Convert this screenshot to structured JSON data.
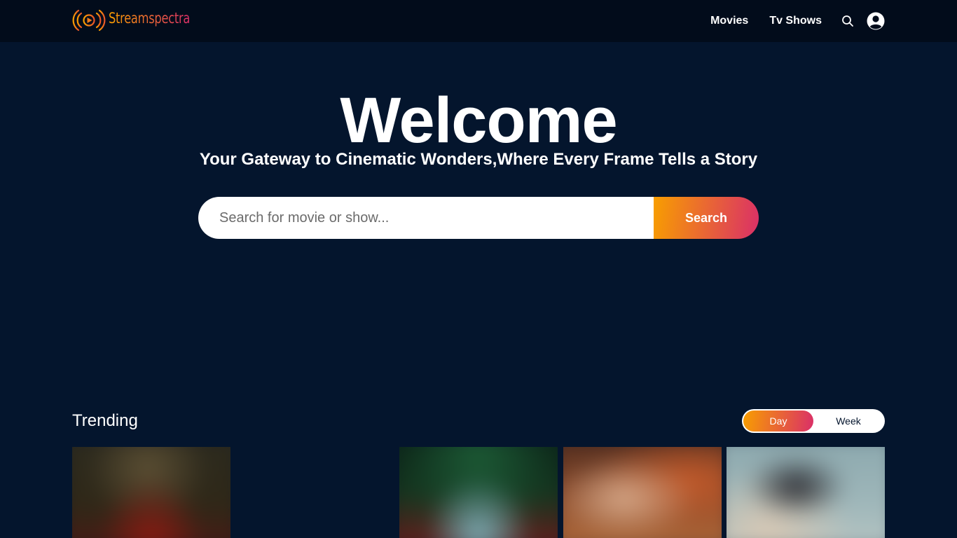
{
  "header": {
    "brand": "Streamspectra",
    "nav": [
      {
        "label": "Movies"
      },
      {
        "label": "Tv Shows"
      }
    ],
    "icons": [
      "search-icon",
      "user-icon"
    ]
  },
  "hero": {
    "title": "Welcome",
    "subtitle": "Your Gateway to Cinematic Wonders,Where Every Frame Tells a Story",
    "search": {
      "placeholder": "Search for movie or show...",
      "value": "",
      "button_label": "Search"
    }
  },
  "trending": {
    "title": "Trending",
    "tabs": [
      {
        "label": "Day",
        "active": true
      },
      {
        "label": "Week",
        "active": false
      }
    ]
  },
  "colors": {
    "background": "#04152d",
    "header": "#020c1b",
    "gradient_start": "#f89e00",
    "gradient_end": "#da2f68",
    "text": "#ffffff"
  }
}
